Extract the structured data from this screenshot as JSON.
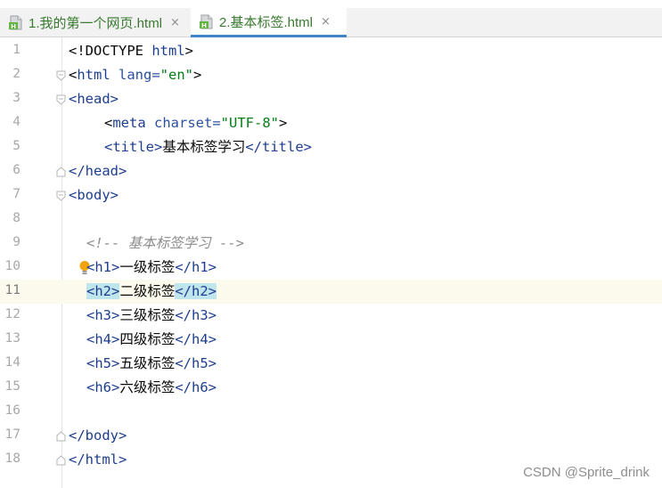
{
  "tabs": [
    {
      "label": "1.我的第一个网页.html",
      "close": "×",
      "icon": "html-file-icon",
      "active": false
    },
    {
      "label": "2.基本标签.html",
      "close": "×",
      "icon": "html-file-icon",
      "active": true
    }
  ],
  "line_numbers": [
    "1",
    "2",
    "3",
    "4",
    "5",
    "6",
    "7",
    "8",
    "9",
    "10",
    "11",
    "12",
    "13",
    "14",
    "15",
    "16",
    "17",
    "18"
  ],
  "code": {
    "doctype": {
      "open": "<!DOCTYPE ",
      "name": "html",
      "close": ">"
    },
    "html_open": {
      "lt": "<",
      "tag": "html",
      "attr": " lang=",
      "val": "\"en\"",
      "gt": ">"
    },
    "head_open": "<head>",
    "meta": {
      "lt": "<",
      "tag": "meta",
      "attr": " charset=",
      "val": "\"UTF-8\"",
      "gt": ">"
    },
    "title": {
      "open": "<title>",
      "text": "基本标签学习",
      "close": "</title>"
    },
    "head_close": "</head>",
    "body_open": "<body>",
    "comment": "<!-- 基本标签学习 -->",
    "headings": [
      {
        "open": "<h1>",
        "text": "一级标签",
        "close": "</h1>"
      },
      {
        "open": "<h2>",
        "text": "二级标签",
        "close": "</h2>"
      },
      {
        "open": "<h3>",
        "text": "三级标签",
        "close": "</h3>"
      },
      {
        "open": "<h4>",
        "text": "四级标签",
        "close": "</h4>"
      },
      {
        "open": "<h5>",
        "text": "五级标签",
        "close": "</h5>"
      },
      {
        "open": "<h6>",
        "text": "六级标签",
        "close": "</h6>"
      }
    ],
    "body_close": "</body>",
    "html_close": "</html>"
  },
  "current_line": 11,
  "watermark": "CSDN @Sprite_drink",
  "colors": {
    "tag": "#1d3e8f",
    "attribute": "#2d4fa0",
    "string": "#067d17",
    "comment": "#8c8c8c",
    "tab_text": "#397a30",
    "active_tab_underline": "#4083c9",
    "current_line_bg": "#fcfaed",
    "tag_match_highlight": "#bfe6ec"
  }
}
